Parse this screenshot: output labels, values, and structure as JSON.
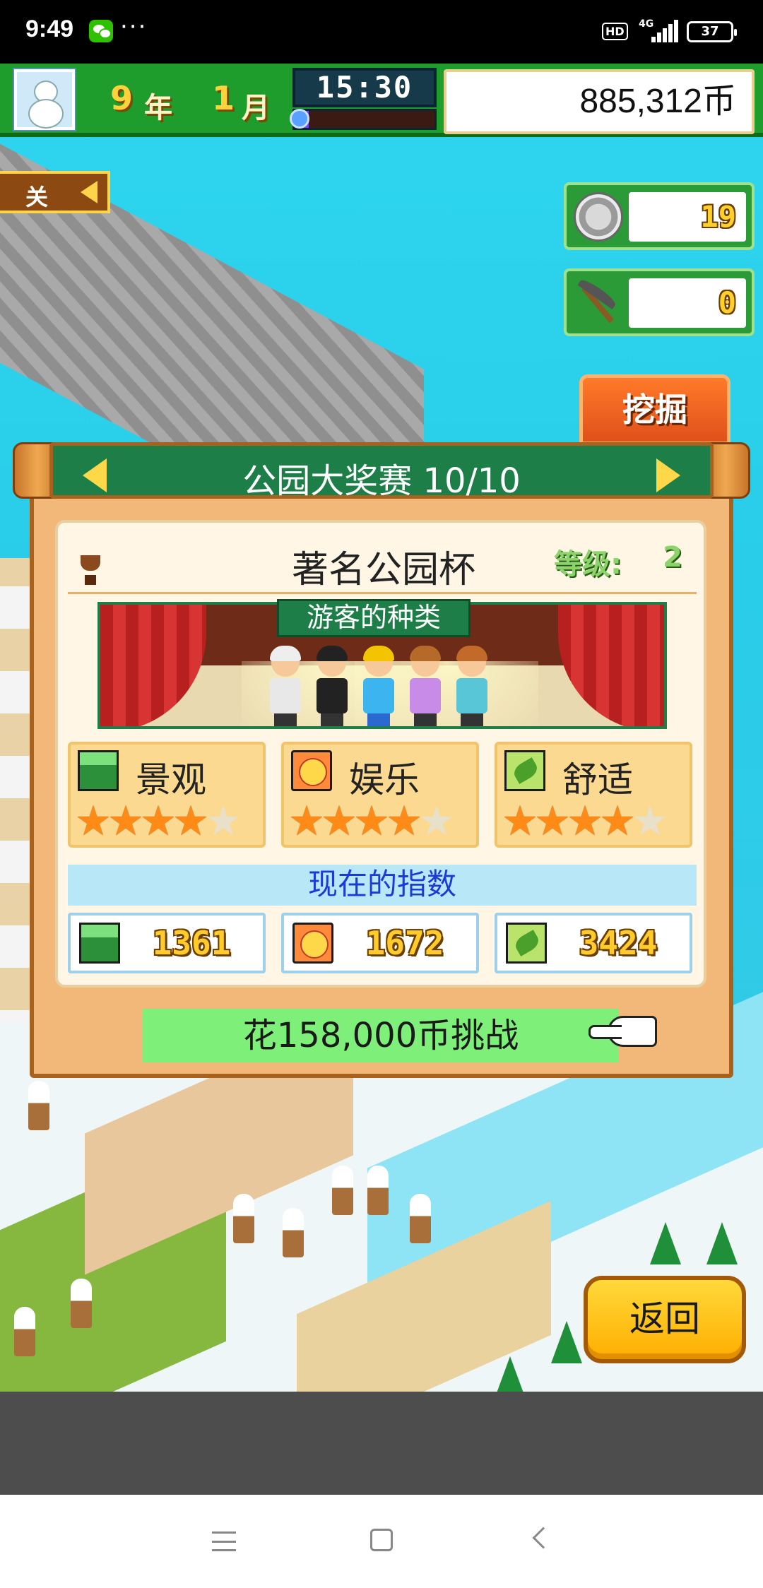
{
  "status_bar": {
    "time": "9:49",
    "more": "···",
    "hd": "HD",
    "network": "4G",
    "battery": "37"
  },
  "hud": {
    "year_value": "9",
    "year_unit": "年",
    "month_value": "1",
    "month_unit": "月",
    "clock": "15:30",
    "day_progress": 0.1,
    "money": "885,312币"
  },
  "side": {
    "tab_label": "关",
    "medals": "19",
    "pickaxes": "0",
    "dig_label": "挖掘"
  },
  "contest": {
    "header": "公园大奖赛 10/10",
    "cup_name": "著名公园杯",
    "rank_label": "等级:",
    "rank_value": "2",
    "visitor_types_label": "游客的种类",
    "categories": [
      {
        "name": "景观",
        "stars": 4,
        "max": 5
      },
      {
        "name": "娱乐",
        "stars": 4,
        "max": 5
      },
      {
        "name": "舒适",
        "stars": 4,
        "max": 5
      }
    ],
    "current_index_label": "现在的指数",
    "current_index": [
      "1361",
      "1672",
      "3424"
    ],
    "challenge_label": "花158,000币挑战"
  },
  "back_label": "返回",
  "colors": {
    "hud_green": "#1e9d2c",
    "header_green": "#1d7e48",
    "dialog_wood": "#f2b879",
    "challenge_green": "#7ef07a",
    "star_orange": "#ff8a16"
  }
}
